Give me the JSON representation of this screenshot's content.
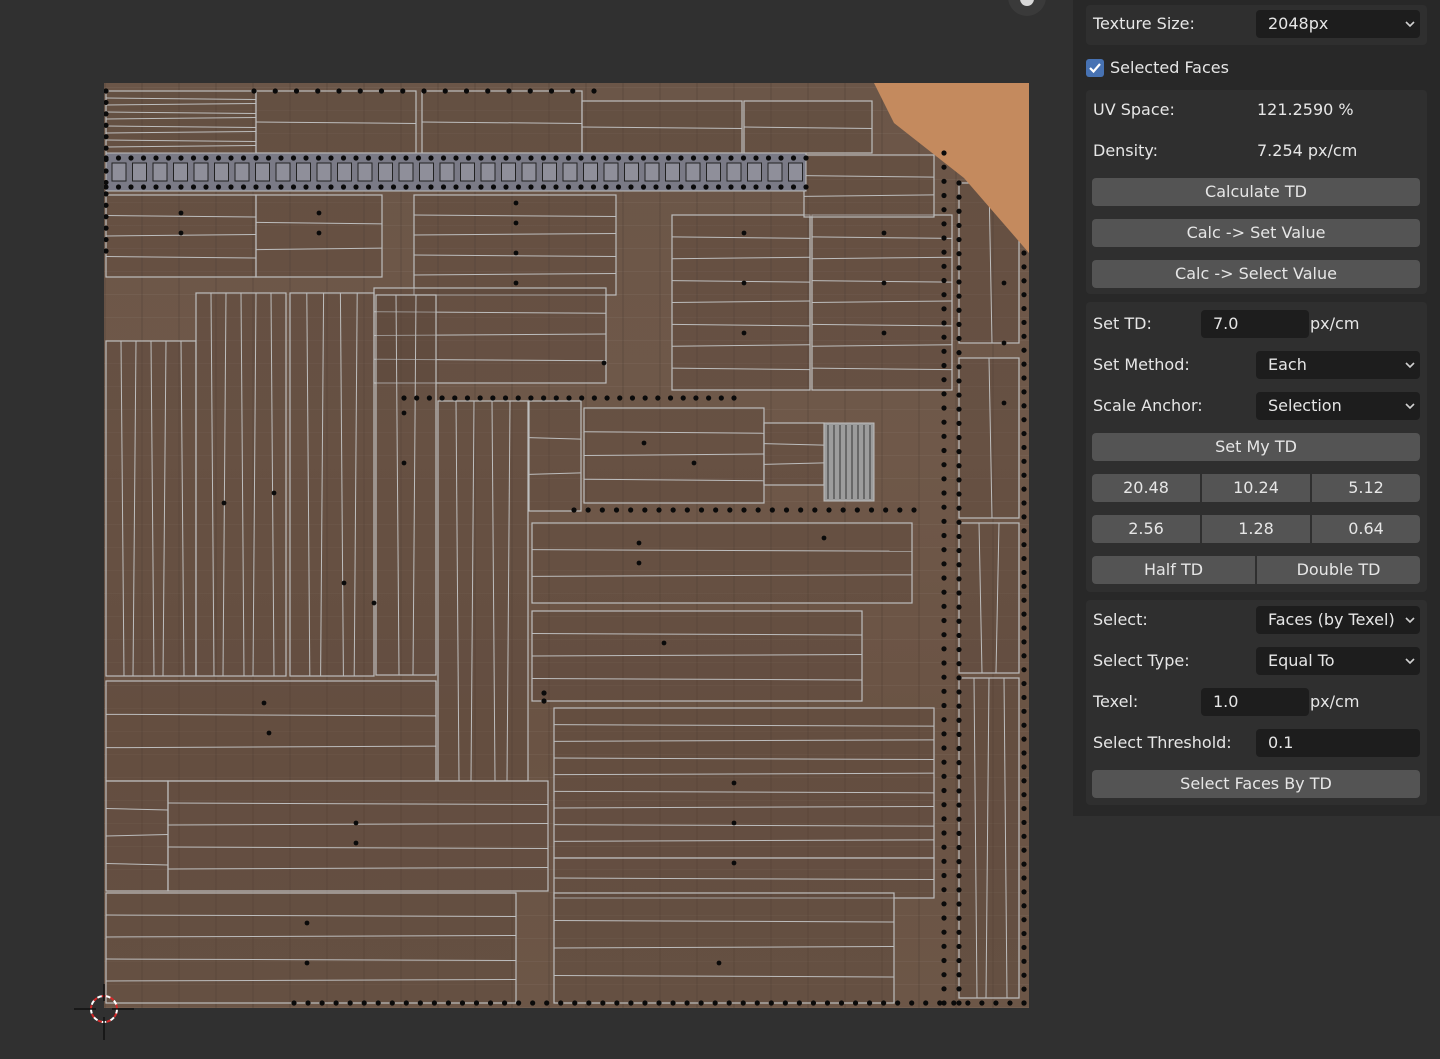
{
  "panel": {
    "texture_size": {
      "label": "Texture Size:",
      "value": "2048px"
    },
    "selected_faces": {
      "label": "Selected Faces",
      "checked": true
    },
    "uv_space": {
      "label": "UV Space:",
      "value": "121.2590 %"
    },
    "density": {
      "label": "Density:",
      "value": "7.254 px/cm"
    },
    "calculate_td": "Calculate TD",
    "calc_set_value": "Calc -> Set Value",
    "calc_select_value": "Calc -> Select Value",
    "set_td": {
      "label": "Set TD:",
      "value": "7.0",
      "unit": "px/cm"
    },
    "set_method": {
      "label": "Set Method:",
      "value": "Each"
    },
    "scale_anchor": {
      "label": "Scale Anchor:",
      "value": "Selection"
    },
    "set_my_td": "Set My TD",
    "presets_row1": [
      "20.48",
      "10.24",
      "5.12"
    ],
    "presets_row2": [
      "2.56",
      "1.28",
      "0.64"
    ],
    "half_td": "Half TD",
    "double_td": "Double TD",
    "select": {
      "label": "Select:",
      "value": "Faces (by Texel)"
    },
    "select_type": {
      "label": "Select Type:",
      "value": "Equal To"
    },
    "texel": {
      "label": "Texel:",
      "value": "1.0",
      "unit": "px/cm"
    },
    "select_threshold": {
      "label": "Select Threshold:",
      "value": "0.1"
    },
    "select_faces_by_td": "Select Faces By TD"
  },
  "icons": {
    "dropdown": "chevron-down-icon",
    "checkbox": "checkmark-icon",
    "gizmo": "hand-pan-icon",
    "cursor": "3d-cursor-icon"
  },
  "colors": {
    "accent": "#4772b3",
    "button": "#545454",
    "field": "#1d1d1d",
    "panel_bg": "#282828",
    "viewport_bg": "#303030",
    "wood": "#6c5647",
    "uv_edge": "#bdbdbd"
  }
}
